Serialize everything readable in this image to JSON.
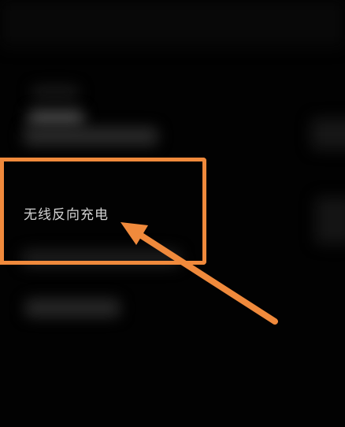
{
  "setting": {
    "label": "无线反向充电"
  },
  "annotation": {
    "color": "#f08a3c"
  },
  "background": {
    "color": "#020202"
  }
}
